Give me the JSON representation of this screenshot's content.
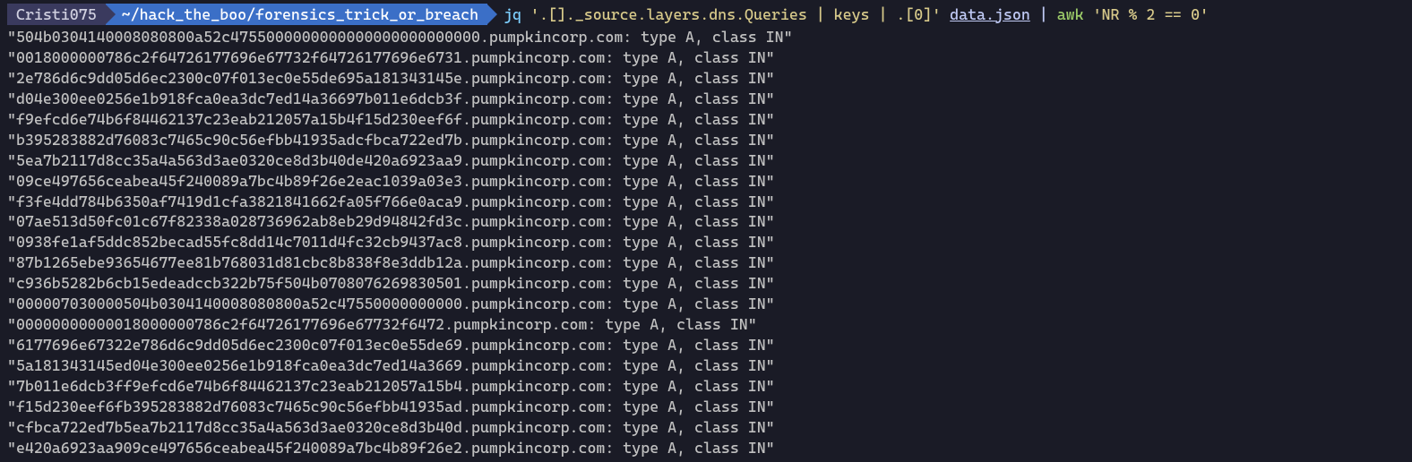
{
  "prompt": {
    "user": "Cristi075",
    "path": "~/hack_the_boo/forensics_trick_or_breach",
    "cmd_jq": "jq",
    "cmd_jq_arg": "'.[]._source.layers.dns.Queries | keys | .[0]'",
    "cmd_file": "data.json",
    "cmd_pipe": "|",
    "cmd_awk": "awk",
    "cmd_awk_arg": "'NR % 2 == 0'"
  },
  "domain_suffix": ".pumpkincorp.com: type A, class IN\"",
  "lines": [
    "\"504b0304140008080800a52c4755000000000000000000000000",
    "\"0018000000786c2f64726177696e67732f64726177696e6731",
    "\"2e786d6c9dd05d6ec2300c07f013ec0e55de695a181343145e",
    "\"d04e300ee0256e1b918fca0ea3dc7ed14a36697b011e6dcb3f",
    "\"f9efcd6e74b6f84462137c23eab212057a15b4f15d230eef6f",
    "\"b395283882d76083c7465c90c56efbb41935adcfbca722ed7b",
    "\"5ea7b2117d8cc35a4a563d3ae0320ce8d3b40de420a6923aa9",
    "\"09ce497656ceabea45f240089a7bc4b89f26e2eac1039a03e3",
    "\"f3fe4dd784b6350af7419d1cfa3821841662fa05f766e0aca9",
    "\"07ae513d50fc01c67f82338a028736962ab8eb29d94842fd3c",
    "\"0938fe1af5ddc852becad55fc8dd14c7011d4fc32cb9437ac8",
    "\"87b1265ebe93654677ee81b768031d81cbc8b838f8e3ddb12a",
    "\"c936b5282b6cb15edeadccb322b75f504b0708076269830501",
    "\"000007030000504b0304140008080800a52c47550000000000",
    "\"00000000000018000000786c2f64726177696e67732f6472",
    "\"6177696e67322e786d6c9dd05d6ec2300c07f013ec0e55de69",
    "\"5a181343145ed04e300ee0256e1b918fca0ea3dc7ed14a3669",
    "\"7b011e6dcb3ff9efcd6e74b6f84462137c23eab212057a15b4",
    "\"f15d230eef6fb395283882d76083c7465c90c56efbb41935ad",
    "\"cfbca722ed7b5ea7b2117d8cc35a4a563d3ae0320ce8d3b40d",
    "\"e420a6923aa909ce497656ceabea45f240089a7bc4b89f26e2"
  ]
}
